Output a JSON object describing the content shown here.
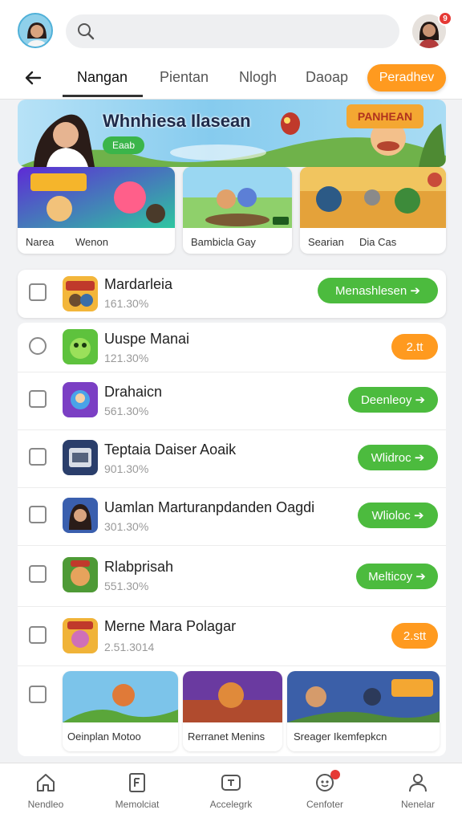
{
  "header": {
    "search_placeholder": "",
    "notification_count": "9"
  },
  "tabs": {
    "items": [
      "Nangan",
      "Pientan",
      "Nlogh",
      "Daoap"
    ],
    "cta": "Peradhev"
  },
  "hero": {
    "title": "Whnhiesa Ilasean",
    "button": "Eaab"
  },
  "cards": [
    {
      "caption_a": "Narea",
      "caption_b": "Wenon"
    },
    {
      "caption_a": "Bambicla Gay"
    },
    {
      "caption_a": "Searian",
      "caption_b": "Dia Cas"
    }
  ],
  "featured": {
    "title": "Mardarleia",
    "sub": "161.30%",
    "button": "Menashlesen ➔"
  },
  "apps": [
    {
      "title": "Uuspe Manai",
      "sub": "121.30%",
      "button": "2.tt",
      "style": "orange"
    },
    {
      "title": "Drahaicn",
      "sub": "561.30%",
      "button": "Deenleoy ➔",
      "style": "green"
    },
    {
      "title": "Teptaia Daiser Aoaik",
      "sub": "901.30%",
      "button": "Wlidroc ➔",
      "style": "green"
    },
    {
      "title": "Uamlan Marturanpdanden Oagdi",
      "sub": "301.30%",
      "button": "Wlioloc ➔",
      "style": "green"
    },
    {
      "title": "Rlabprisah",
      "sub": "551.30%",
      "button": "Melticoy ➔",
      "style": "green"
    },
    {
      "title": "Merne Mara Polagar",
      "sub": "2.51.3014",
      "button": "2.stt",
      "style": "orange"
    }
  ],
  "bottom_cards": [
    {
      "caption": "Oeinplan Motoo"
    },
    {
      "caption": "Rerranet Menins"
    },
    {
      "caption": "Sreager Ikemfepkcn"
    }
  ],
  "nav": [
    {
      "label": "Nendleo",
      "icon": "home-icon"
    },
    {
      "label": "Memolciat",
      "icon": "bookmark-icon"
    },
    {
      "label": "Accelegrk",
      "icon": "card-icon"
    },
    {
      "label": "Cenfoter",
      "icon": "game-icon"
    },
    {
      "label": "Nenelar",
      "icon": "profile-icon"
    }
  ],
  "colors": {
    "green": "#4cbb3e",
    "orange": "#ff9a1f",
    "notif": "#e53935"
  }
}
